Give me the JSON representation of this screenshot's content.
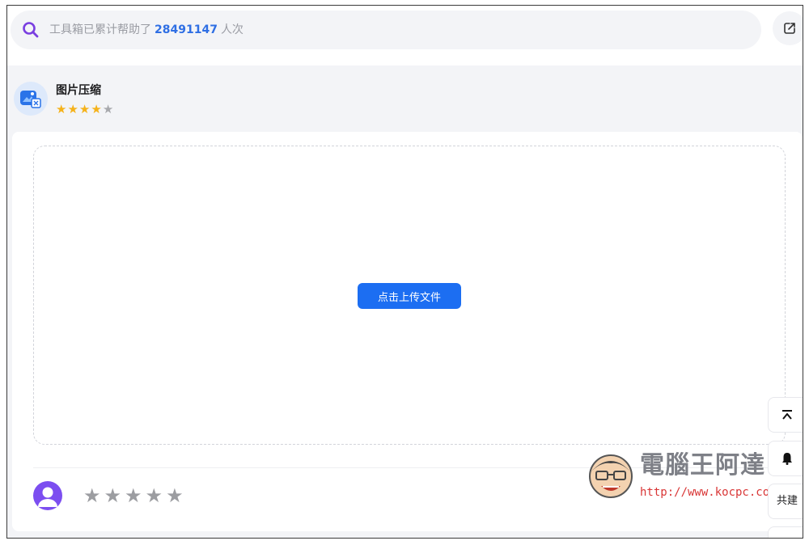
{
  "search": {
    "prefix": "工具箱已累计帮助了",
    "count": "28491147",
    "suffix": "人次"
  },
  "tool": {
    "title": "图片压缩",
    "rating": {
      "filled": 4,
      "total": 5
    }
  },
  "upload": {
    "button_label": "点击上传文件"
  },
  "feedback": {
    "stars": 5
  },
  "side_buttons": {
    "back_to_top_icon": "⌅",
    "bell_icon": "bell-icon",
    "share_label": "共建"
  },
  "watermark": {
    "title": "電腦王阿達",
    "url": "http://www.kocpc.com.tw"
  },
  "colors": {
    "accent": "#1c6ef2",
    "search_icon": "#7a3fe0",
    "count": "#2f6fe4",
    "star_on": "#f5b21a",
    "star_off": "#a8a9ad",
    "avatar": "#7c4ef0"
  }
}
